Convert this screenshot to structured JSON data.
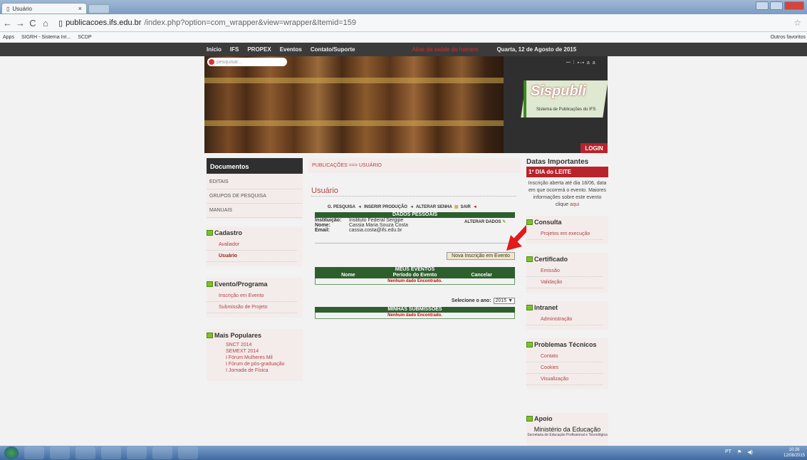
{
  "browser": {
    "tab_title": "Usuário",
    "tab_close": "×",
    "back": "←",
    "forward": "→",
    "reload": "C",
    "home": "⌂",
    "url_host": "publicacoes.ifs.edu.br",
    "url_path": "/index.php?option=com_wrapper&view=wrapper&Itemid=159",
    "star": "☆",
    "bookmarks": [
      "Apps",
      "SIGRH - Sistema Int...",
      "SCDP"
    ],
    "other_bookmarks": "Outros favoritos"
  },
  "site": {
    "topnav": [
      "Início",
      "IFS",
      "PROPEX",
      "Eventos",
      "Contato/Suporte"
    ],
    "alert": "Atlas da saúde do homem",
    "date": "Quarta, 12 de Agosto de 2015",
    "search_placeholder": "pesquisar...",
    "header_tools": "ꟷ ⁞ ▪▫▪ a a",
    "logo_title": "Sispubli",
    "logo_subtitle": "Sistema de Publicações do IFS",
    "login": "LOGIN"
  },
  "left": {
    "documentos_title": "Documentos",
    "documentos": [
      "EDITAIS",
      "GRUPOS DE PESQUISA",
      "MANUAIS"
    ],
    "cadastro_title": "Cadastro",
    "cadastro": [
      "Avaliador",
      "Usuário"
    ],
    "evento_title": "Evento/Programa",
    "evento": [
      "Inscrição em Evento",
      "Submissão de Projeto"
    ],
    "populares_title": "Mais Populares",
    "populares": [
      "SNCT 2014",
      "SEMEXT 2014",
      "I Fórum Mulheres Mil",
      "I Fórum de pós-graduação",
      "I Jornada de Física"
    ]
  },
  "main": {
    "breadcrumb": "PUBLICAÇÕES ==> USUÁRIO",
    "title": "Usuário",
    "actions": [
      "G. PESQUISA",
      "INSERIR PRODUÇÃO",
      "ALTERAR SENHA",
      "SAIR"
    ],
    "dados_header": "DADOS PESSOAIS",
    "instituicao_label": "Instituição:",
    "instituicao": "Instituto Federal Sergipe",
    "nome_label": "Nome:",
    "nome": "Cassia Maria Souza Costa",
    "email_label": "Email:",
    "email": "cassia.costa@ifs.edu.br",
    "alterar_dados": "ALTERAR DADOS",
    "nova_inscricao": "Nova Inscrição em Evento",
    "meus_eventos_header": "MEUS EVENTOS",
    "meus_cols": [
      "Nome",
      "Período do Evento",
      "Cancelar"
    ],
    "nenhum": "Nenhum dado Encontrado.",
    "selecione": "Selecione o ano:",
    "ano": "2015",
    "submissoes_header": "MINHAS SUBMISSÕES"
  },
  "right": {
    "datas_title": "Datas Importantes",
    "leite": "1º DIA do LEITE",
    "leite_text": "Inscrição aberta até dia 18/06, data em que ocorrerá o evento. Maiores informações sobre este evento clique",
    "aqui": "aqui",
    "consulta_title": "Consulta",
    "consulta": [
      "Projetos em execução"
    ],
    "certificado_title": "Certificado",
    "certificado": [
      "Emissão",
      "Validação"
    ],
    "intranet_title": "Intranet",
    "intranet": [
      "Administração"
    ],
    "problemas_title": "Problemas Técnicos",
    "problemas": [
      "Contato",
      "Cookies",
      "Visualização"
    ],
    "apoio_title": "Apoio",
    "mec": "Ministério da Educação",
    "mec_sub": "Secretaria de Educação Profissional e Tecnológica"
  },
  "taskbar": {
    "lang": "PT",
    "time": "10:26",
    "date": "12/08/2015"
  },
  "colors": {
    "accent_red": "#b8232c",
    "table_green": "#2d5f2d",
    "dark": "#2f2f2f"
  }
}
